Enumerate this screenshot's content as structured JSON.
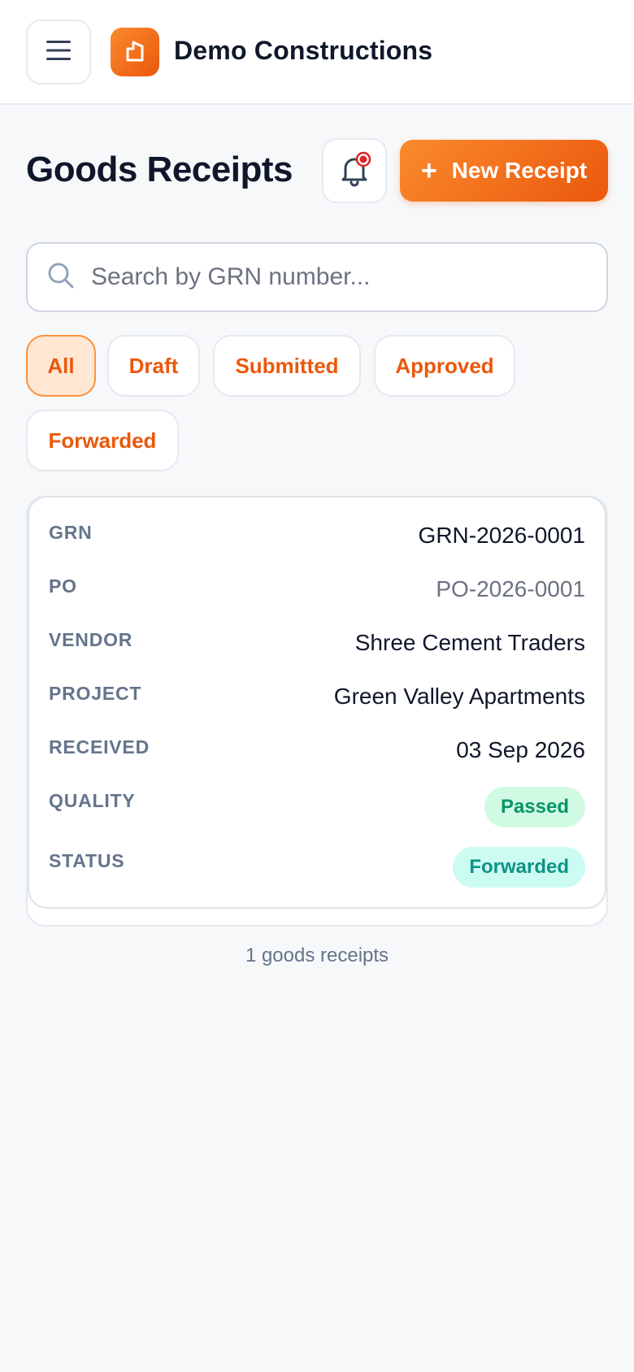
{
  "header": {
    "company_name": "Demo Constructions",
    "menu_icon": "hamburger-menu-icon",
    "logo_icon": "building-logo-icon"
  },
  "page": {
    "title": "Goods Receipts",
    "new_button_label": "New Receipt",
    "new_button_icon": "plus-icon",
    "bell_icon": "bell-icon"
  },
  "search": {
    "placeholder": "Search by GRN number...",
    "value": ""
  },
  "filters": [
    {
      "label": "All",
      "active": true
    },
    {
      "label": "Draft",
      "active": false
    },
    {
      "label": "Submitted",
      "active": false
    },
    {
      "label": "Approved",
      "active": false
    },
    {
      "label": "Forwarded",
      "active": false
    }
  ],
  "receipt": {
    "grn_label": "GRN",
    "grn": "GRN-2026-0001",
    "po_label": "PO",
    "po": "PO-2026-0001",
    "vendor_label": "VENDOR",
    "vendor": "Shree Cement Traders",
    "project_label": "PROJECT",
    "project": "Green Valley Apartments",
    "received_label": "RECEIVED",
    "received": "03 Sep 2026",
    "quality_label": "QUALITY",
    "quality": "Passed",
    "status_label": "STATUS",
    "status": "Forwarded"
  },
  "footer": {
    "count_text": "1 goods receipts"
  },
  "colors": {
    "accent": "#ea580c",
    "accent_light": "#fb8a2e",
    "chip_active_bg": "#ffe7d3",
    "passed_bg": "#d1fae5",
    "passed_text": "#059669",
    "forwarded_bg": "#ccfbf1",
    "forwarded_text": "#0d9488",
    "notification_dot": "#dc2626"
  }
}
